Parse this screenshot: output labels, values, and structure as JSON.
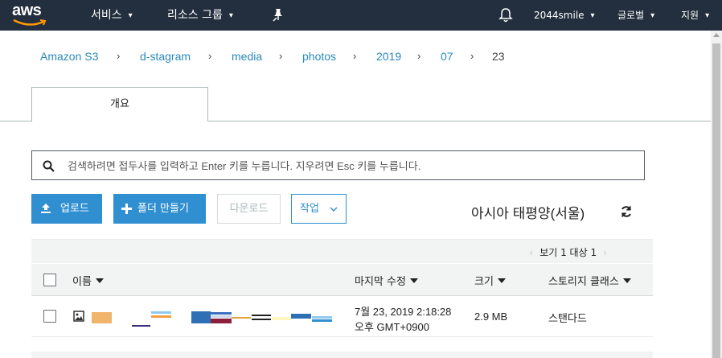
{
  "nav": {
    "logo_text": "aws",
    "services": "서비스",
    "resource_groups": "리소스 그룹",
    "account": "2044smile",
    "global": "글로벌",
    "support": "지원",
    "colors": {
      "bar": "#232f3e",
      "smile": "#ff9900"
    }
  },
  "breadcrumb": [
    {
      "label": "Amazon S3",
      "link": true
    },
    {
      "label": "d-stagram",
      "link": true
    },
    {
      "label": "media",
      "link": true
    },
    {
      "label": "photos",
      "link": true
    },
    {
      "label": "2019",
      "link": true
    },
    {
      "label": "07",
      "link": true
    },
    {
      "label": "23",
      "link": false
    }
  ],
  "tabs": [
    {
      "label": "개요",
      "active": true
    }
  ],
  "search": {
    "placeholder": "검색하려면 접두사를 입력하고 Enter 키를 누릅니다. 지우려면 Esc 키를 누릅니다.",
    "value": ""
  },
  "toolbar": {
    "upload": "업로드",
    "create_folder": "폴더 만들기",
    "download": "다운로드",
    "actions": "작업",
    "region": "아시아 태평양(서울)",
    "accent": "#2f8fd0"
  },
  "pagination": {
    "label": "보기 1 대상 1"
  },
  "table": {
    "columns": {
      "name": "이름",
      "modified": "마지막 수정",
      "size": "크기",
      "storage_class": "스토리지 클래스"
    },
    "rows": [
      {
        "name": "",
        "modified_line1": "7월 23, 2019 2:18:28",
        "modified_line2": "오후 GMT+0900",
        "size": "2.9 MB",
        "storage_class": "스탠다드",
        "icon": "image-file-icon"
      }
    ]
  }
}
